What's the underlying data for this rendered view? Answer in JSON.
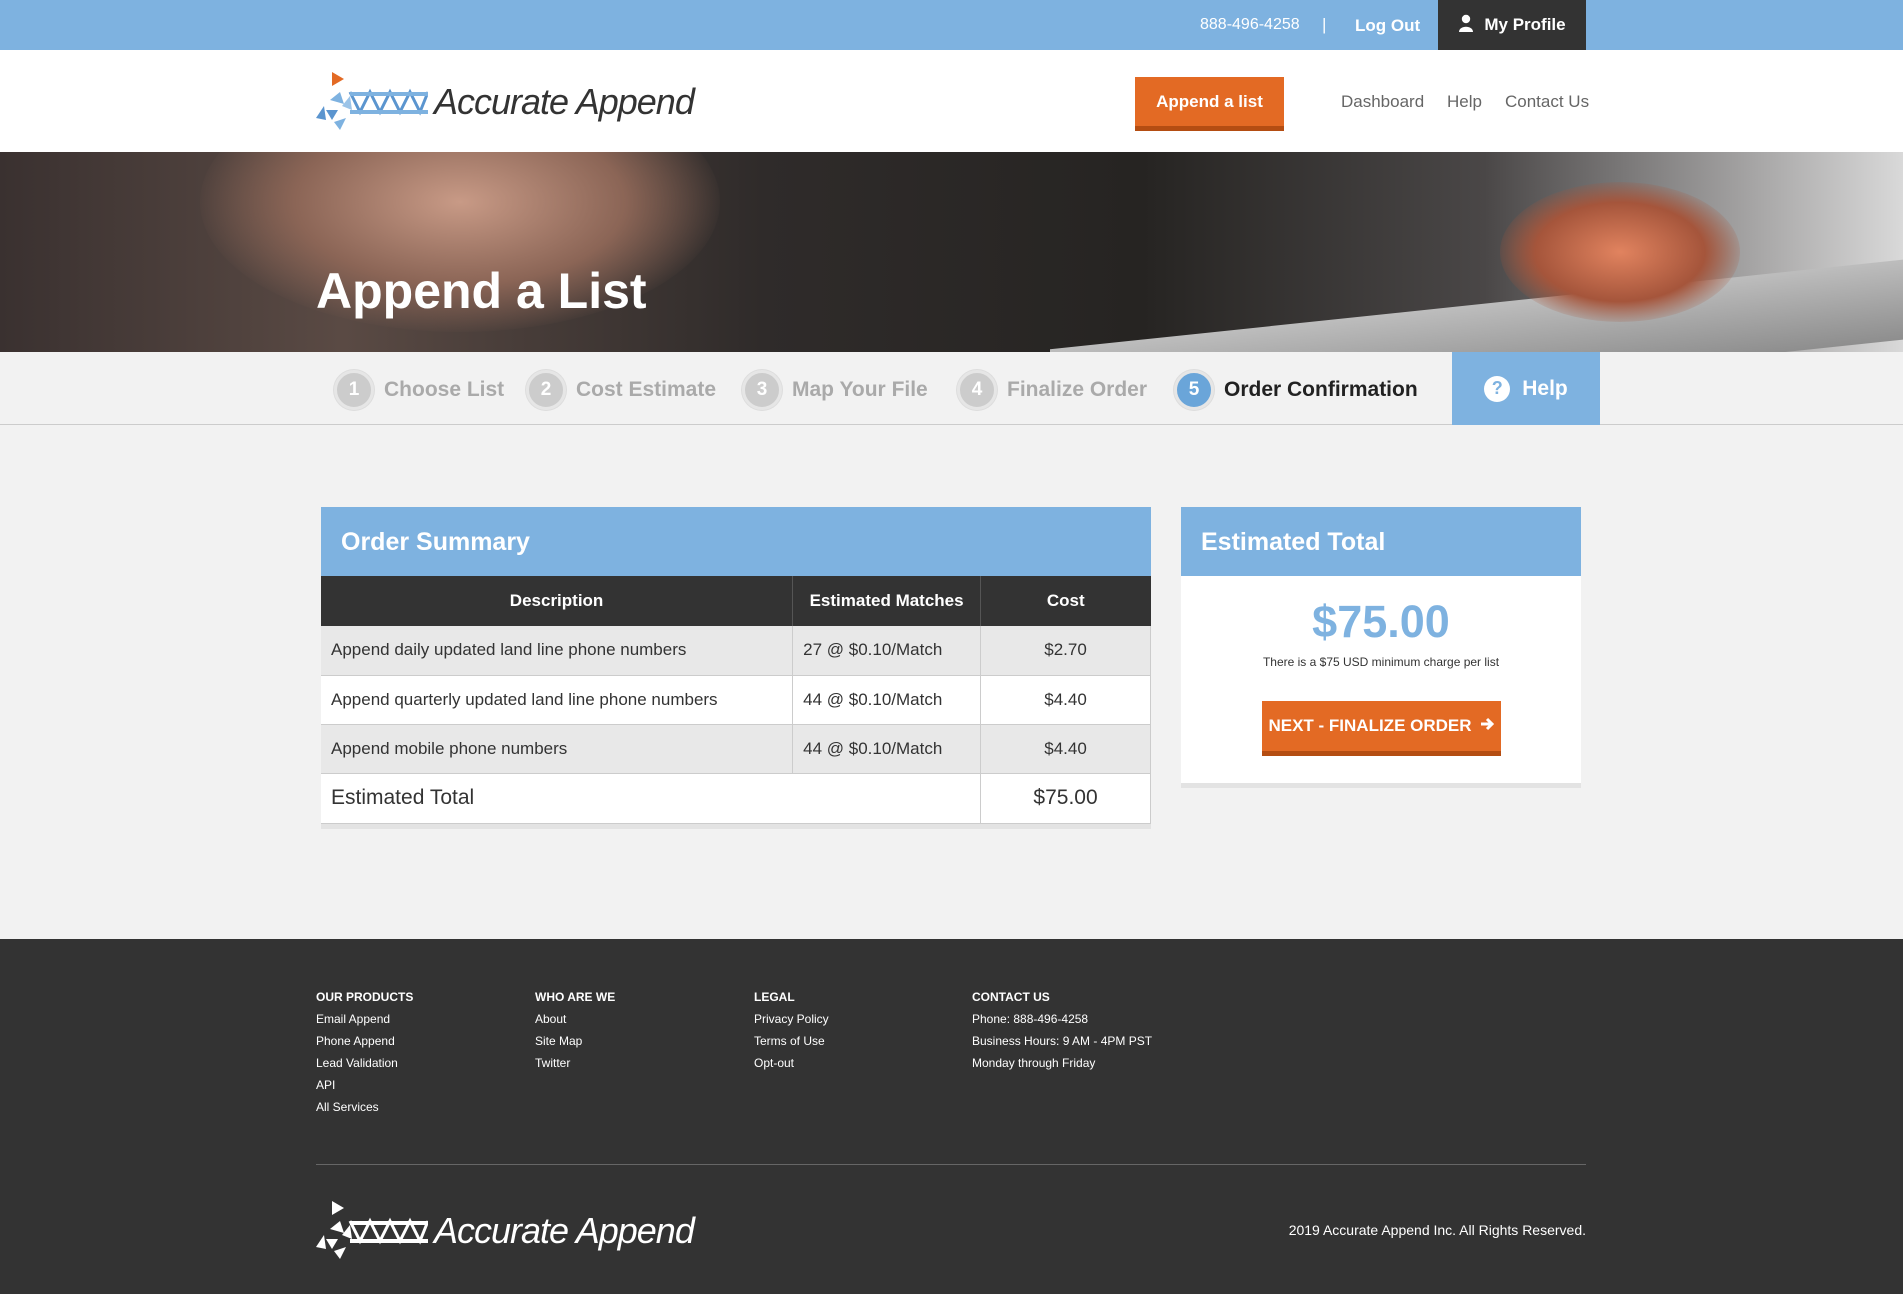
{
  "topbar": {
    "phone": "888-496-4258",
    "separator": "|",
    "logout_label": "Log Out",
    "profile_label": "My Profile",
    "profile_icon": "user-icon"
  },
  "header": {
    "logo_text": "Accurate Append",
    "cta_label": "Append a list",
    "nav": [
      "Dashboard",
      "Help",
      "Contact Us"
    ]
  },
  "hero": {
    "title": "Append a List"
  },
  "steps": [
    {
      "num": "1",
      "label": "Choose List",
      "state": "inactive"
    },
    {
      "num": "2",
      "label": "Cost Estimate",
      "state": "inactive"
    },
    {
      "num": "3",
      "label": "Map Your File",
      "state": "inactive"
    },
    {
      "num": "4",
      "label": "Finalize Order",
      "state": "inactive"
    },
    {
      "num": "5",
      "label": "Order Confirmation",
      "state": "active"
    }
  ],
  "help_tab": {
    "icon": "question-icon",
    "label": "Help"
  },
  "order_summary": {
    "title": "Order Summary",
    "columns": [
      "Description",
      "Estimated Matches",
      "Cost"
    ],
    "rows": [
      {
        "description": "Append daily updated land line phone numbers",
        "matches": "27 @ $0.10/Match",
        "cost": "$2.70"
      },
      {
        "description": "Append quarterly updated land line phone numbers",
        "matches": "44 @ $0.10/Match",
        "cost": "$4.40"
      },
      {
        "description": "Append mobile phone numbers",
        "matches": "44 @ $0.10/Match",
        "cost": "$4.40"
      }
    ],
    "total_label": "Estimated Total",
    "total_value": "$75.00"
  },
  "estimate": {
    "title": "Estimated Total",
    "amount": "$75.00",
    "note": "There is a $75 USD minimum charge per list",
    "next_label": "NEXT - FINALIZE ORDER",
    "next_icon": "arrow-right-icon"
  },
  "footer": {
    "columns": [
      {
        "heading": "OUR PRODUCTS",
        "items": [
          "Email Append",
          "Phone Append",
          "Lead Validation",
          "API",
          "All Services"
        ]
      },
      {
        "heading": "WHO ARE WE",
        "items": [
          "About",
          "Site Map",
          "Twitter"
        ]
      },
      {
        "heading": "LEGAL",
        "items": [
          "Privacy Policy",
          "Terms of Use",
          "Opt-out"
        ]
      },
      {
        "heading": "CONTACT US",
        "items": [
          "Phone: 888-496-4258",
          "Business Hours: 9 AM - 4PM PST",
          "Monday through Friday"
        ]
      }
    ],
    "logo_text": "Accurate Append",
    "copyright": "2019 Accurate Append Inc. All Rights Reserved."
  },
  "colors": {
    "accent_blue": "#7eb2e0",
    "accent_orange": "#e36a24",
    "dark": "#333333"
  }
}
